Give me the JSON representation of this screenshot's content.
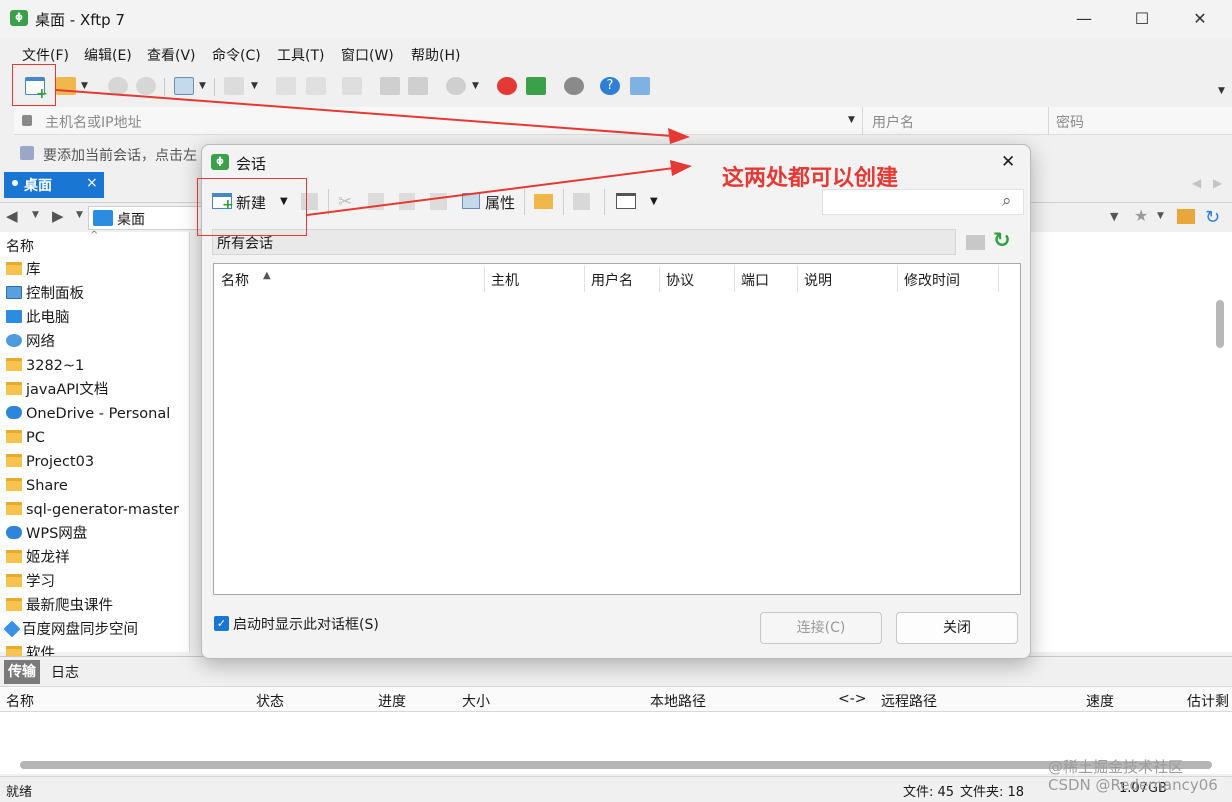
{
  "window": {
    "title": "桌面 - Xftp 7",
    "logo": "xftp-logo"
  },
  "menu": [
    "文件(F)",
    "编辑(E)",
    "查看(V)",
    "命令(C)",
    "工具(T)",
    "窗口(W)",
    "帮助(H)"
  ],
  "address": {
    "host_placeholder": "主机名或IP地址",
    "user_placeholder": "用户名",
    "password_placeholder": "密码"
  },
  "hint": "要添加当前会话，点击左",
  "tab": {
    "label": "桌面",
    "close": "×"
  },
  "nav": {
    "path": "桌面"
  },
  "filelist": {
    "header": "名称",
    "items": [
      {
        "name": "库",
        "icon": "folder"
      },
      {
        "name": "控制面板",
        "icon": "control-panel"
      },
      {
        "name": "此电脑",
        "icon": "computer"
      },
      {
        "name": "网络",
        "icon": "network"
      },
      {
        "name": "3282~1",
        "icon": "folder"
      },
      {
        "name": "javaAPI文档",
        "icon": "folder"
      },
      {
        "name": "OneDrive - Personal",
        "icon": "cloud"
      },
      {
        "name": "PC",
        "icon": "folder"
      },
      {
        "name": "Project03",
        "icon": "folder"
      },
      {
        "name": "Share",
        "icon": "folder"
      },
      {
        "name": "sql-generator-master",
        "icon": "folder"
      },
      {
        "name": "WPS网盘",
        "icon": "cloud"
      },
      {
        "name": "姬龙祥",
        "icon": "folder"
      },
      {
        "name": "学习",
        "icon": "folder"
      },
      {
        "name": "最新爬虫课件",
        "icon": "folder"
      },
      {
        "name": "百度网盘同步空间",
        "icon": "baidu"
      },
      {
        "name": "软件",
        "icon": "folder"
      }
    ]
  },
  "dialog": {
    "title": "会话",
    "close": "✕",
    "new_label": "新建",
    "properties_label": "属性",
    "folder_label": "所有会话",
    "columns": [
      "名称",
      "主机",
      "用户名",
      "协议",
      "端口",
      "说明",
      "修改时间"
    ],
    "checkbox_label": "启动时显示此对话框(S)",
    "checkbox_checked": true,
    "connect_label": "连接(C)",
    "close_label": "关闭"
  },
  "transfer": {
    "tabs": [
      "传输",
      "日志"
    ],
    "columns": [
      "名称",
      "状态",
      "进度",
      "大小",
      "本地路径",
      "<->",
      "远程路径",
      "速度",
      "估计剩"
    ]
  },
  "status": {
    "ready": "就绪",
    "files": "文件: 45",
    "folders": "文件夹: 18",
    "size": "1.07GB"
  },
  "annotation": {
    "text": "这两处都可以创建",
    "color": "#e53935"
  },
  "watermark": {
    "line1": "@稀土掘金技术社区",
    "line2": "CSDN @Redemancy06"
  },
  "colors": {
    "accent": "#1976d2",
    "annotation": "#e53935",
    "folder": "#f6c34e"
  }
}
